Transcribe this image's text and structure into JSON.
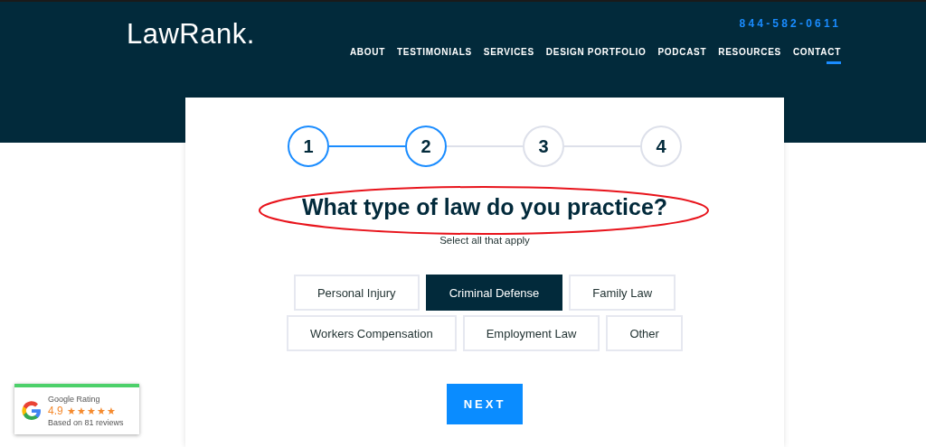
{
  "header": {
    "logo": "LawRank.",
    "phone": "844-582-0611",
    "nav": [
      {
        "label": "ABOUT",
        "selected": false
      },
      {
        "label": "TESTIMONIALS",
        "selected": false
      },
      {
        "label": "SERVICES",
        "selected": false
      },
      {
        "label": "DESIGN PORTFOLIO",
        "selected": false
      },
      {
        "label": "PODCAST",
        "selected": false
      },
      {
        "label": "RESOURCES",
        "selected": false
      },
      {
        "label": "CONTACT",
        "selected": true
      }
    ]
  },
  "steps": [
    {
      "label": "1",
      "active": true
    },
    {
      "label": "2",
      "active": true
    },
    {
      "label": "3",
      "active": false
    },
    {
      "label": "4",
      "active": false
    }
  ],
  "question": {
    "title": "What type of law do you practice?",
    "highlighted": true,
    "hint": "Select all that apply"
  },
  "options": [
    [
      {
        "label": "Personal Injury",
        "selected": false
      },
      {
        "label": "Criminal Defense",
        "selected": true
      },
      {
        "label": "Family Law",
        "selected": false
      }
    ],
    [
      {
        "label": "Workers Compensation",
        "selected": false
      },
      {
        "label": "Employment Law",
        "selected": false
      },
      {
        "label": "Other",
        "selected": false
      }
    ]
  ],
  "next_button": "NEXT",
  "rating_badge": {
    "title": "Google Rating",
    "score": "4.9",
    "stars": 5,
    "reviews": "Based on 81 reviews"
  }
}
